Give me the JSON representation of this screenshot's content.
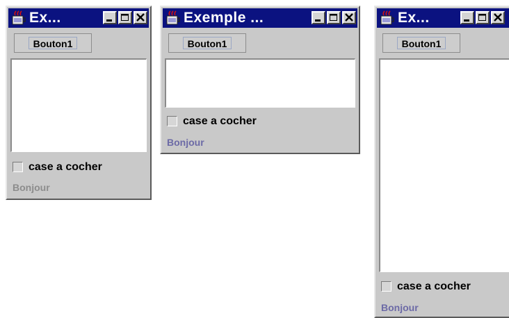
{
  "colors": {
    "title_bar": "#0b1280",
    "panel": "#c9c9c9",
    "bonjour_grey": "#8c8c8c",
    "bonjour_purple": "#6c6aa6"
  },
  "windows": [
    {
      "title": "Ex...",
      "icon": "java-cup-icon",
      "button_label": "Bouton1",
      "checkbox_label": "case a cocher",
      "label_text": "Bonjour"
    },
    {
      "title": "Exemple ...",
      "icon": "java-cup-icon",
      "button_label": "Bouton1",
      "checkbox_label": "case a cocher",
      "label_text": "Bonjour"
    },
    {
      "title": "Ex...",
      "icon": "java-cup-icon",
      "button_label": "Bouton1",
      "checkbox_label": "case a cocher",
      "label_text": "Bonjour"
    }
  ]
}
